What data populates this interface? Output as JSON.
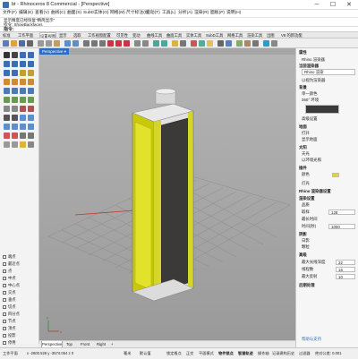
{
  "window": {
    "title": "bt - Rhinoceros 8 Commercial - [Perspective]",
    "min": "─",
    "max": "☐",
    "close": "✕"
  },
  "menu": [
    "文件(F)",
    "编辑(E)",
    "查看(V)",
    "曲线(C)",
    "曲面(S)",
    "SubD",
    "实体(O)",
    "网格(M)",
    "尺寸标注(D)",
    "变动(T)",
    "工具(L)",
    "分析(A)",
    "渲染(R)",
    "面板(P)",
    "说明(H)"
  ],
  "command_history": [
    "显示精度已经恢复\"精简显示\"",
    "指令: ShowBackfaces"
  ],
  "command_prompt": "指令:",
  "toolbar_tabs": [
    "标准",
    "工作平面",
    "设置视图",
    "显示",
    "选取",
    "工作视窗配置",
    "可见性",
    "变动",
    "曲线工具",
    "曲面工具",
    "实体工具",
    "SubD工具",
    "网格工具",
    "渲染工具",
    "出图",
    "V8 的新功能"
  ],
  "toolbar_tab_active": 2,
  "osnaps": [
    "端点",
    "最近点",
    "点",
    "中点",
    "中心点",
    "交点",
    "垂点",
    "切点",
    "四分点",
    "节点",
    "顶点",
    "投影",
    "停用"
  ],
  "viewport": {
    "label": "Perspective",
    "dropdown": "▾",
    "axis_x": "x",
    "axis_y": "y"
  },
  "viewport_tabs": [
    "Perspective",
    "Top",
    "Front",
    "Right",
    "+"
  ],
  "viewport_tab_active": 0,
  "panel": {
    "section_tabs": "属性",
    "items": [
      "Rhino 渲染器",
      "当前渲染器",
      "Rhino 渲染",
      "以视为渲染器",
      "背景",
      "单一颜色",
      "360° 环境",
      "高级设置",
      "地面",
      "打开",
      "显示地面",
      "太阳",
      "天光",
      "以环境光照",
      "插件",
      "颜色",
      "灯光",
      "Rhino 渲染器设置",
      "渲染设置",
      "品质",
      "最长时间",
      "阴影",
      "日影",
      "颗粒",
      "高级",
      "后期处理"
    ],
    "fields": {
      "sample_label": "取样",
      "sample_value": "128",
      "time_label": "时间(秒)",
      "time_value": "1000",
      "ray_depth_label": "最大光线深度",
      "ray_depth_value": "32",
      "threads_label": "线程数",
      "threads_value": "16",
      "max_bounce_label": "最大反射",
      "max_bounce_value": "10"
    },
    "bottom_link": "帮助与支持",
    "accent": "#2e6cc0"
  },
  "status": {
    "cplane": "工作平面",
    "coords": "x -2600.528   y -3574.054   z 0",
    "units": "毫米",
    "layer": "默认值",
    "toggles": [
      "锁定格点",
      "正交",
      "平面模式",
      "物件锁点",
      "智慧轨迹",
      "操作轴",
      "记录建构历史",
      "过滤器"
    ],
    "toggle_on": [
      3,
      4
    ],
    "cpu": "绝对公差: 0.001"
  }
}
